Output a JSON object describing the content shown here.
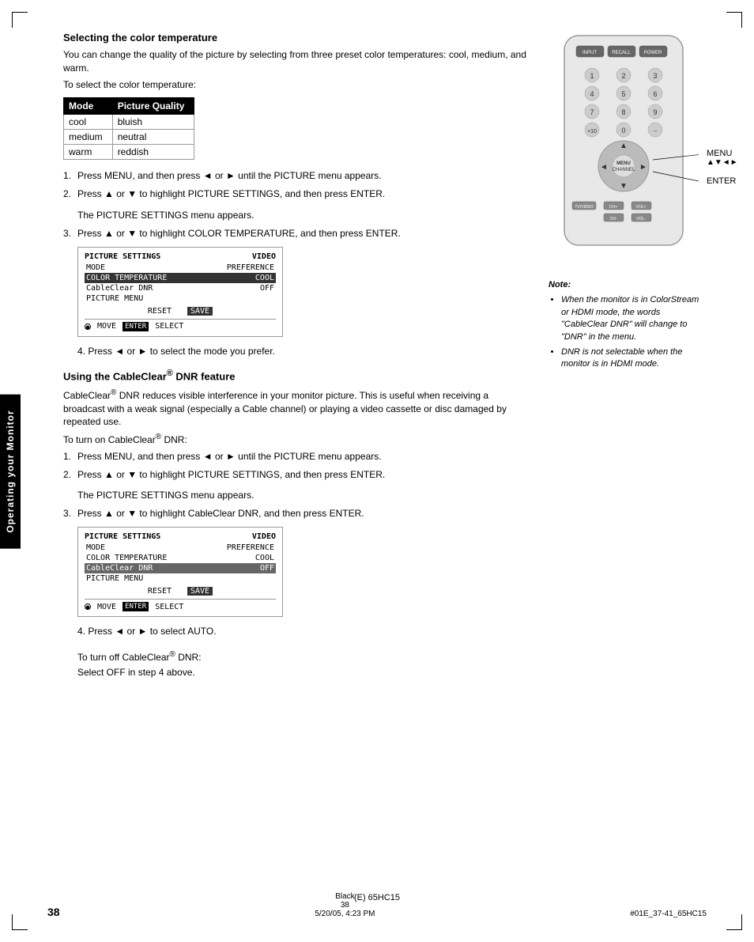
{
  "page": {
    "number": "38",
    "footer_left": "#01E_37-41_65HC15",
    "footer_center": "38",
    "footer_date": "5/20/05, 4:23 PM",
    "footer_color": "Black",
    "model": "(E) 65HC15"
  },
  "side_tab": "Operating your Monitor",
  "section1": {
    "title": "Selecting the color temperature",
    "intro1": "You can change the quality of the picture by selecting from three preset color temperatures: cool, medium, and warm.",
    "intro2": "To select the color temperature:",
    "table": {
      "headers": [
        "Mode",
        "Picture Quality"
      ],
      "rows": [
        [
          "cool",
          "bluish"
        ],
        [
          "medium",
          "neutral"
        ],
        [
          "warm",
          "reddish"
        ]
      ]
    },
    "steps": [
      {
        "num": "1.",
        "text": "Press MENU, and then press ◄ or ► until the PICTURE menu appears."
      },
      {
        "num": "2.",
        "text": "Press ▲ or ▼ to highlight PICTURE SETTINGS, and then press ENTER."
      },
      {
        "sub": "The PICTURE SETTINGS menu appears."
      },
      {
        "num": "3.",
        "text": "Press ▲ or ▼ to highlight COLOR TEMPERATURE, and then press ENTER."
      }
    ],
    "menu1": {
      "title_left": "PICTURE SETTINGS",
      "title_right": "VIDEO",
      "rows": [
        {
          "label": "MODE",
          "value": "PREFERENCE",
          "style": "normal"
        },
        {
          "label": "COLOR TEMPERATURE",
          "value": "COOL",
          "style": "highlighted"
        },
        {
          "label": "CableClear  DNR",
          "value": "OFF",
          "style": "normal"
        },
        {
          "label": "PICTURE MENU",
          "value": "",
          "style": "normal"
        }
      ],
      "buttons": [
        "RESET",
        "SAVE"
      ],
      "bottom": "MOVE  ENTER  SELECT"
    },
    "step4": "4. Press ◄ or ► to select the mode you prefer."
  },
  "section2": {
    "title": "Using the CableClear® DNR feature",
    "intro1": "CableClear® DNR reduces visible interference in your monitor picture. This is useful when receiving a broadcast with a weak signal (especially a Cable channel) or playing a video cassette or disc damaged by repeated use.",
    "intro2": "To turn on CableClear® DNR:",
    "steps": [
      {
        "num": "1.",
        "text": "Press MENU, and then press ◄ or ► until the PICTURE menu appears."
      },
      {
        "num": "2.",
        "text": "Press ▲ or ▼ to highlight PICTURE SETTINGS, and then press ENTER."
      },
      {
        "sub": "The PICTURE SETTINGS menu appears."
      },
      {
        "num": "3.",
        "text": "Press ▲ or ▼ to highlight CableClear DNR, and then press ENTER."
      }
    ],
    "menu2": {
      "title_left": "PICTURE SETTINGS",
      "title_right": "VIDEO",
      "rows": [
        {
          "label": "MODE",
          "value": "PREFERENCE",
          "style": "normal"
        },
        {
          "label": "COLOR TEMPERATURE",
          "value": "COOL",
          "style": "normal"
        },
        {
          "label": "CableClear  DNR",
          "value": "OFF",
          "style": "highlighted2"
        },
        {
          "label": "PICTURE MENU",
          "value": "",
          "style": "normal"
        }
      ],
      "buttons": [
        "RESET",
        "SAVE"
      ],
      "bottom": "MOVE  ENTER  SELECT"
    },
    "step4": "4. Press ◄ or ► to select AUTO.",
    "turn_off_title": "To turn off CableClear® DNR:",
    "turn_off_text": "Select OFF in step 4 above."
  },
  "note": {
    "title": "Note:",
    "bullets": [
      "When the monitor is in ColorStream or HDMI mode, the words \"CableClear DNR\" will change to \"DNR\" in the menu.",
      "DNR is not selectable when the monitor is in HDMI mode."
    ]
  },
  "menu_label": "MENU",
  "arrows_label": "▲▼◄►",
  "enter_label": "ENTER"
}
